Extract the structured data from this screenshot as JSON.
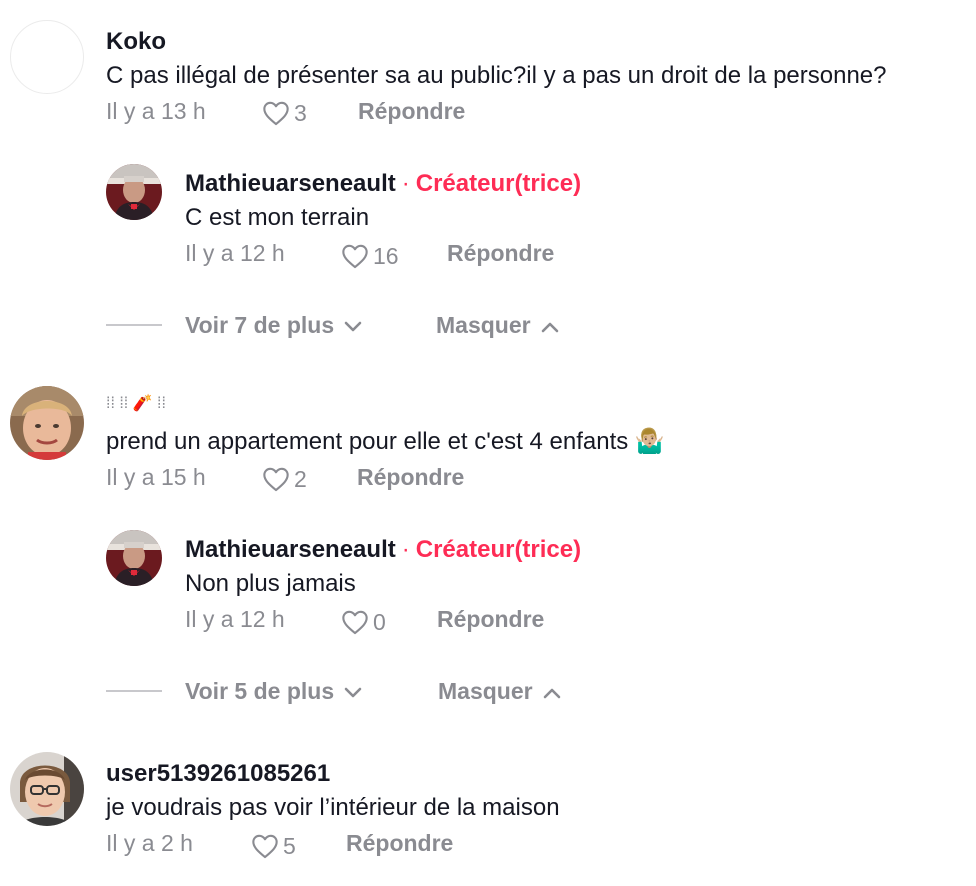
{
  "colors": {
    "text_primary": "#161823",
    "text_secondary": "#8a8b91",
    "creator_accent": "#fe2c55",
    "divider": "#c8c8cc"
  },
  "comments": [
    {
      "username": "Koko",
      "text": "C pas illégal de présenter sa au public?il y a pas un droit de la personne?",
      "time": "Il y a 13 h",
      "likes": "3",
      "reply_label": "Répondre",
      "replies": [
        {
          "username": "Mathieuarseneault",
          "creator_dot": "·",
          "creator_label": "Créateur(trice)",
          "text": "C est mon terrain",
          "time": "Il y a 12 h",
          "likes": "16",
          "reply_label": "Répondre"
        }
      ],
      "more_label": "Voir 7 de plus",
      "hide_label": "Masquer"
    },
    {
      "username": "⁞⁞ ⁞⁞ 🧨 ⁞⁞",
      "text": "prend un appartement pour elle et c'est 4 enfants 🤷🏼‍♂️",
      "time": "Il y a 15 h",
      "likes": "2",
      "reply_label": "Répondre",
      "replies": [
        {
          "username": "Mathieuarseneault",
          "creator_dot": "·",
          "creator_label": "Créateur(trice)",
          "text": "Non plus jamais",
          "time": "Il y a 12 h",
          "likes": "0",
          "reply_label": "Répondre"
        }
      ],
      "more_label": "Voir 5 de plus",
      "hide_label": "Masquer"
    },
    {
      "username": "user5139261085261",
      "text": "je voudrais pas voir l’intérieur de la maison",
      "time": "Il y a 2 h",
      "likes": "5",
      "reply_label": "Répondre"
    }
  ]
}
